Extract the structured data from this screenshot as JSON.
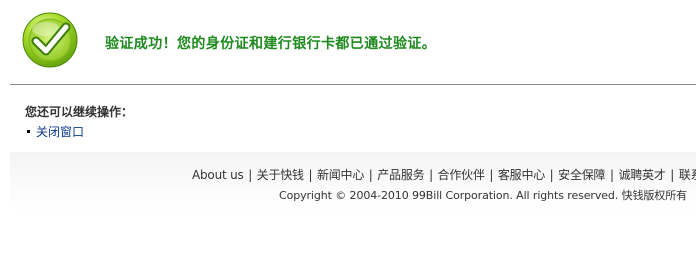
{
  "header": {
    "message": "验证成功！您的身份证和建行银行卡都已通过验证。",
    "icon": "check-icon",
    "accent_color": "#1e8a1e"
  },
  "operations": {
    "title": "您还可以继续操作：",
    "items": [
      {
        "label": "关闭窗口"
      }
    ]
  },
  "footer": {
    "links": [
      {
        "label": "About us"
      },
      {
        "label": "关于快钱"
      },
      {
        "label": "新闻中心"
      },
      {
        "label": "产品服务"
      },
      {
        "label": "合作伙伴"
      },
      {
        "label": "客服中心"
      },
      {
        "label": "安全保障"
      },
      {
        "label": "诚聘英才"
      },
      {
        "label": "联系我"
      }
    ],
    "separator": "|",
    "copyright": "Copyright © 2004-2010 99Bill Corporation. All rights reserved. 快钱版权所有"
  }
}
